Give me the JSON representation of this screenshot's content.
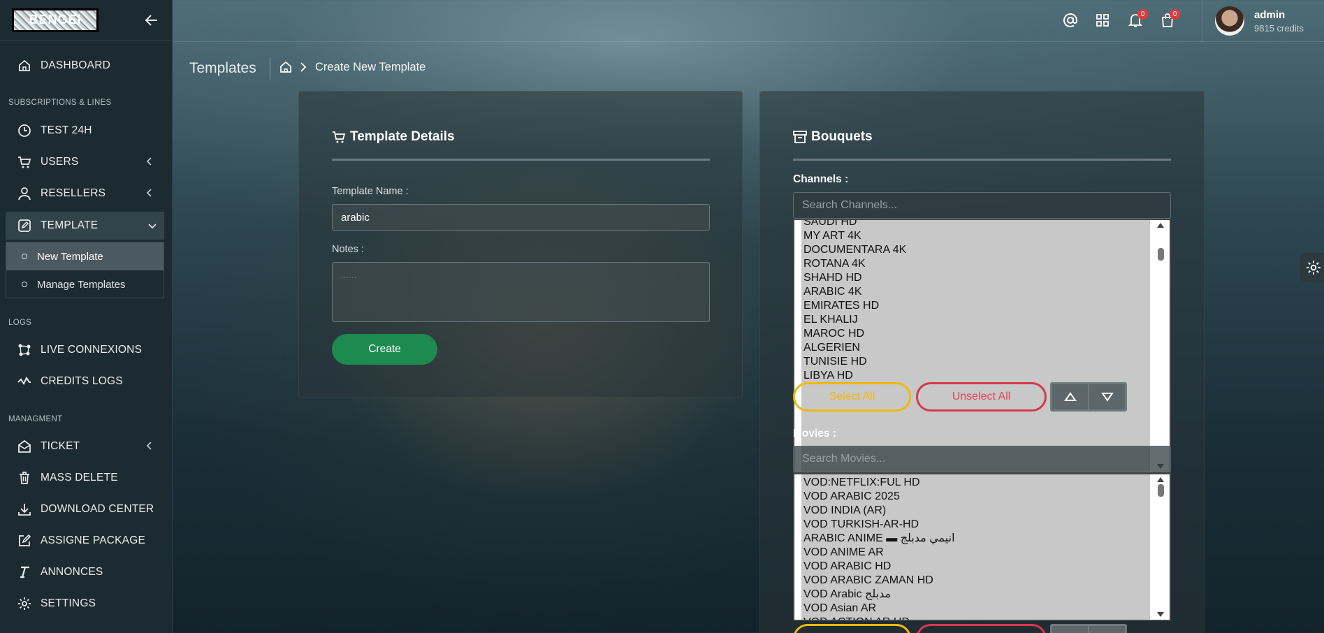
{
  "sidebar": {
    "logo_text": "BENGEI",
    "items": {
      "dashboard": "DASHBOARD",
      "test24h": "TEST 24H",
      "users": "USERS",
      "resellers": "RESELLERS",
      "template": "TEMPLATE",
      "live": "LIVE CONNEXIONS",
      "credits": "CREDITS LOGS",
      "ticket": "TICKET",
      "mass_delete": "MASS DELETE",
      "download": "DOWNLOAD CENTER",
      "assign": "ASSIGNE PACKAGE",
      "annonces": "ANNONCES",
      "settings": "SETTINGS"
    },
    "sections": {
      "subs": "SUBSCRIPTIONS & LINES",
      "logs": "LOGS",
      "manage": "MANAGMENT"
    },
    "submenu": {
      "new_template": "New Template",
      "manage_templates": "Manage Templates"
    }
  },
  "topbar": {
    "notifications_count": "0",
    "cart_count": "0",
    "user_name": "admin",
    "user_credits": "9815 credits"
  },
  "breadcrumb": {
    "page_title": "Templates",
    "current": "Create New Template"
  },
  "template_card": {
    "title": "Template Details",
    "name_label": "Template Name :",
    "name_value": "arabic",
    "notes_label": "Notes :",
    "notes_placeholder": "......",
    "create_label": "Create"
  },
  "bouquets_card": {
    "title": "Bouquets",
    "channels_label": "Channels :",
    "channels_search_placeholder": "Search Channels...",
    "channels": [
      "SAUDI HD",
      "MY ART 4K",
      "DOCUMENTARA 4K",
      "ROTANA 4K",
      "SHAHD HD",
      "ARABIC 4K",
      "EMIRATES HD",
      "EL KHALIJ",
      "MAROC HD",
      "ALGERIEN",
      "TUNISIE HD",
      "LIBYA HD"
    ],
    "select_all": "Select All",
    "unselect_all": "Unselect All",
    "movies_label": "Movies :",
    "movies_search_placeholder": "Search Movies...",
    "movies": [
      "VOD:NETFLIX:FUL HD",
      "VOD ARABIC 2025",
      "VOD INDIA (AR)",
      "VOD TURKISH-AR-HD",
      "ARABIC ANIME ▬ انيمي مدبلج",
      "VOD ANIME AR",
      "VOD ARABIC HD",
      "VOD ARABIC ZAMAN HD",
      "VOD Arabic مدبلج",
      "VOD Asian AR",
      "VOD ACTION AR HD"
    ]
  },
  "colors": {
    "accent_green": "#1d8a4f",
    "select_yellow": "#f2b80f",
    "unselect_red": "#d4394e",
    "badge_red": "#e23b3b"
  }
}
